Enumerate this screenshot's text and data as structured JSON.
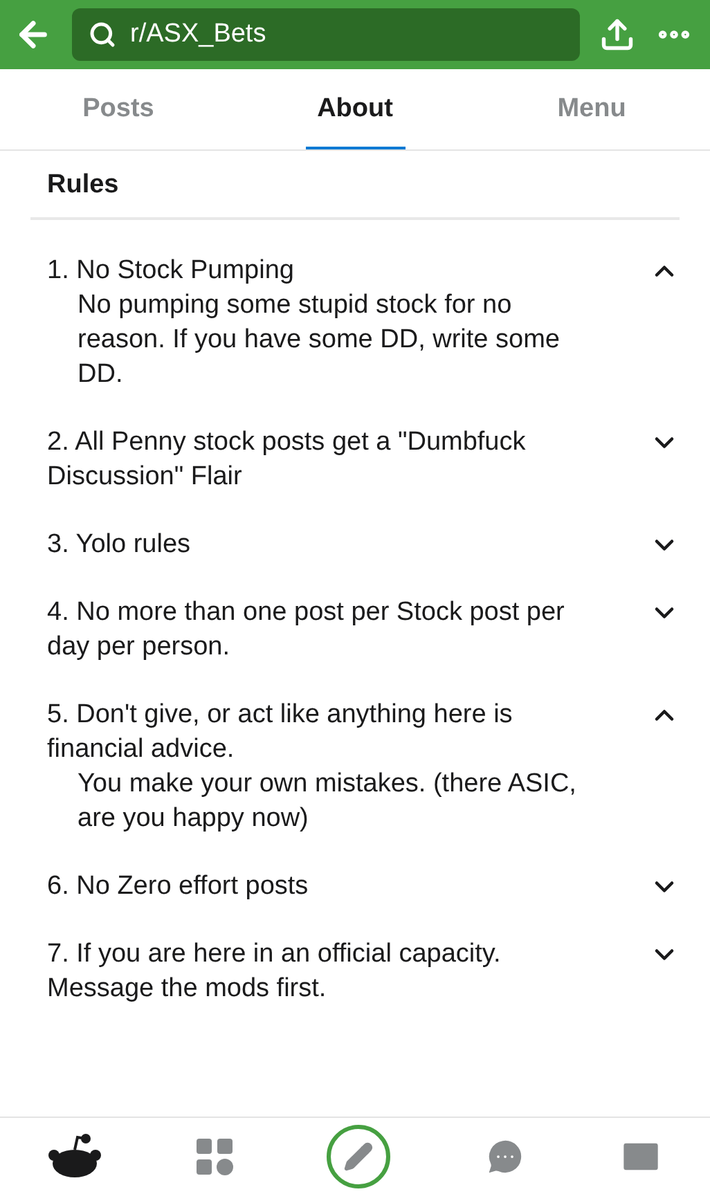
{
  "search": {
    "value": "r/ASX_Bets"
  },
  "tabs": [
    {
      "label": "Posts",
      "selected": false
    },
    {
      "label": "About",
      "selected": true
    },
    {
      "label": "Menu",
      "selected": false
    }
  ],
  "section_title": "Rules",
  "rules": [
    {
      "title": "1. No Stock Pumping",
      "expanded": true,
      "description": "No pumping some stupid stock for no reason. If you have some DD, write some DD."
    },
    {
      "title": "2. All Penny stock posts get a \"Dumbfuck Discussion\" Flair",
      "expanded": false
    },
    {
      "title": "3. Yolo rules",
      "expanded": false
    },
    {
      "title": "4. No more than one post per Stock post per day per person.",
      "expanded": false
    },
    {
      "title": "5. Don't give, or act like anything here is financial advice.",
      "expanded": true,
      "description": "You make your own mistakes. (there ASIC, are you happy now)"
    },
    {
      "title": "6. No Zero effort posts",
      "expanded": false
    },
    {
      "title": "7. If you are here in an official capacity. Message the mods first.",
      "expanded": false
    }
  ],
  "bottom_nav": [
    {
      "kind": "home",
      "selected": true
    },
    {
      "kind": "communities",
      "selected": false
    },
    {
      "kind": "create",
      "selected": false
    },
    {
      "kind": "chat",
      "selected": false
    },
    {
      "kind": "inbox",
      "selected": false
    }
  ]
}
